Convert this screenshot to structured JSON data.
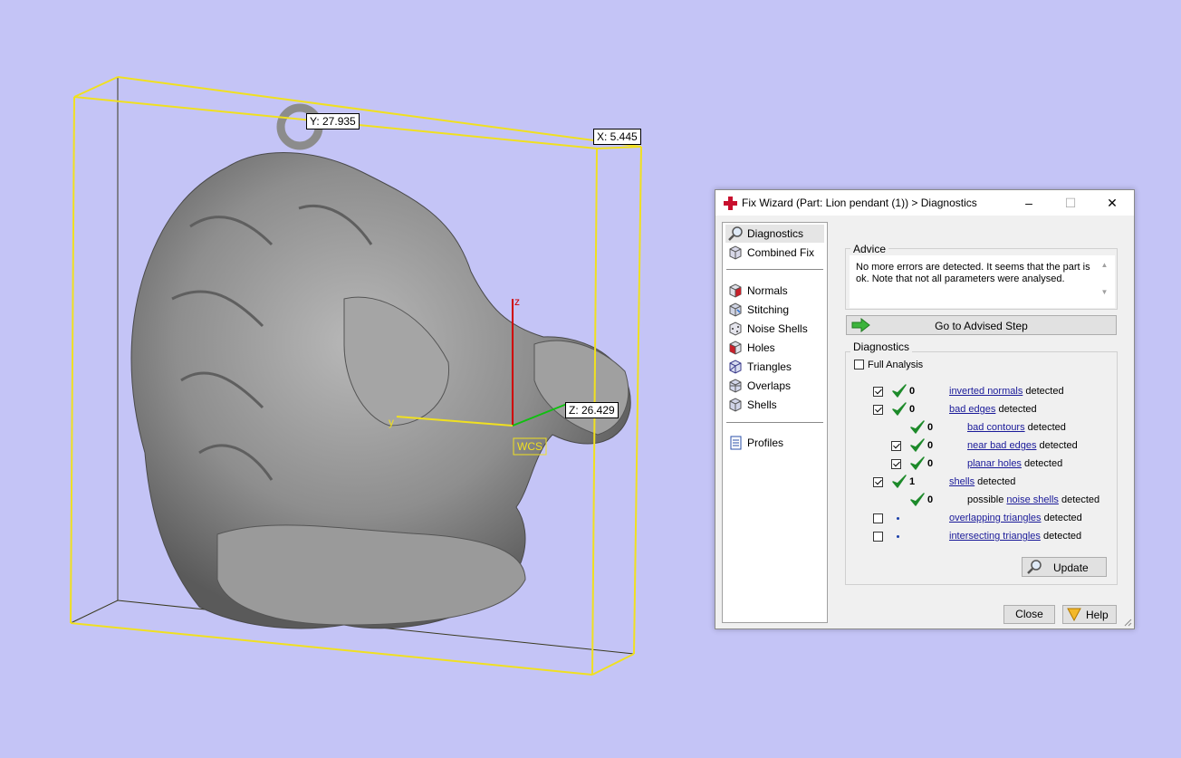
{
  "viewport": {
    "dim_y": "Y: 27.935",
    "dim_x": "X: 5.445",
    "dim_z": "Z: 26.429",
    "axis_z_label": "z",
    "axis_y_label": "y",
    "wcs_label": "WCS",
    "colors": {
      "background": "#c4c4f6",
      "bbox": "#f0e020",
      "axis_z": "#d00000",
      "axis_y": "#f0e020",
      "axis_x": "#10c010",
      "model": "#8a8a8a"
    }
  },
  "dialog": {
    "title": "Fix Wizard (Part: Lion pendant (1)) > Diagnostics",
    "minimize_icon": "–",
    "maximize_icon": "☐",
    "close_icon": "✕",
    "nav": {
      "top": [
        {
          "label": "Diagnostics",
          "icon": "magnifier-icon",
          "selected": true
        },
        {
          "label": "Combined Fix",
          "icon": "cube-icon",
          "selected": false
        }
      ],
      "steps": [
        {
          "label": "Normals",
          "icon": "normals-cube-icon"
        },
        {
          "label": "Stitching",
          "icon": "stitching-cube-icon"
        },
        {
          "label": "Noise Shells",
          "icon": "noise-shells-icon"
        },
        {
          "label": "Holes",
          "icon": "holes-cube-icon"
        },
        {
          "label": "Triangles",
          "icon": "triangles-cube-icon"
        },
        {
          "label": "Overlaps",
          "icon": "overlaps-cube-icon"
        },
        {
          "label": "Shells",
          "icon": "shells-cube-icon"
        }
      ],
      "bottom": [
        {
          "label": "Profiles",
          "icon": "profiles-icon"
        }
      ]
    },
    "advice": {
      "title": "Advice",
      "text": "No more errors are detected. It seems that the part is ok. Note that not all parameters were analysed."
    },
    "goto_button": "Go to Advised Step",
    "diagnostics": {
      "title": "Diagnostics",
      "full_analysis_label": "Full Analysis",
      "full_analysis_checked": false,
      "rows": [
        {
          "indent": 0,
          "checkbox": true,
          "checked": true,
          "status": "ok",
          "count": "0",
          "prefix": "",
          "link": "inverted normals",
          "suffix": " detected"
        },
        {
          "indent": 0,
          "checkbox": true,
          "checked": true,
          "status": "ok",
          "count": "0",
          "prefix": "",
          "link": "bad edges",
          "suffix": " detected"
        },
        {
          "indent": 1,
          "checkbox": false,
          "checked": false,
          "status": "ok",
          "count": "0",
          "prefix": "",
          "link": "bad contours",
          "suffix": " detected"
        },
        {
          "indent": 1,
          "checkbox": true,
          "checked": true,
          "status": "ok",
          "count": "0",
          "prefix": "",
          "link": "near bad edges",
          "suffix": " detected"
        },
        {
          "indent": 1,
          "checkbox": true,
          "checked": true,
          "status": "ok",
          "count": "0",
          "prefix": "",
          "link": "planar holes",
          "suffix": " detected"
        },
        {
          "indent": 0,
          "checkbox": true,
          "checked": true,
          "status": "ok",
          "count": "1",
          "prefix": "",
          "link": "shells",
          "suffix": " detected"
        },
        {
          "indent": 1,
          "checkbox": false,
          "checked": false,
          "status": "ok",
          "count": "0",
          "prefix": "possible ",
          "link": "noise shells",
          "suffix": " detected"
        },
        {
          "indent": 0,
          "checkbox": true,
          "checked": false,
          "status": "pending",
          "count": "",
          "prefix": "",
          "link": "overlapping triangles",
          "suffix": " detected"
        },
        {
          "indent": 0,
          "checkbox": true,
          "checked": false,
          "status": "pending",
          "count": "",
          "prefix": "",
          "link": "intersecting triangles",
          "suffix": " detected"
        }
      ],
      "update_button": "Update"
    },
    "close_button": "Close",
    "help_button": "Help"
  }
}
